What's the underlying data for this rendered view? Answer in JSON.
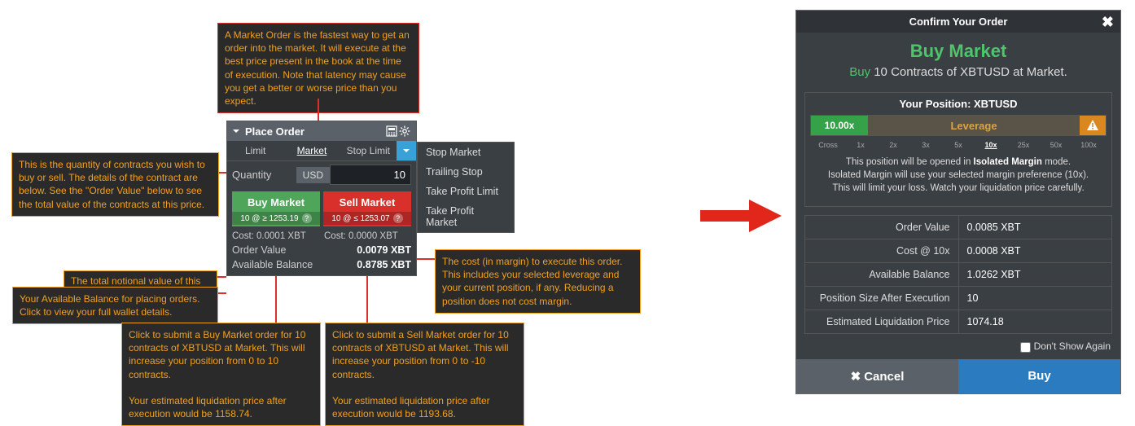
{
  "tooltip_market": "A Market Order is the fastest way to get an order into the market. It will execute at the best price present in the book at the time of execution. Note that latency may cause you get a better or worse price than you expect.",
  "tooltip_quantity": "This is the quantity of contracts you wish to buy or sell. The details of the contract are below. See the \"Order Value\" below to see the total value of the contracts at this price.",
  "tooltip_order_value": "The total notional value of this order.",
  "tooltip_avail": "Your Available Balance for placing orders. Click to view your full wallet details.",
  "tooltip_buy": "Click to submit a Buy Market order for 10 contracts of XBTUSD at Market. This will increase your position from 0 to 10 contracts.\n\nYour estimated liquidation price after execution would be 1158.74.",
  "tooltip_sell": "Click to submit a Sell Market order for 10 contracts of XBTUSD at Market. This will increase your position from 0 to -10 contracts.\n\nYour estimated liquidation price after execution would be 1193.68.",
  "tooltip_cost": "The cost (in margin) to execute this order. This includes your selected leverage and your current position, if any. Reducing a position does not cost margin.",
  "panel": {
    "title": "Place Order",
    "tabs": [
      "Limit",
      "Market",
      "Stop Limit"
    ],
    "qty_label": "Quantity",
    "ccy": "USD",
    "qty_value": "10",
    "buy_label": "Buy Market",
    "buy_sub": "10 @ ≥ 1253.19",
    "sell_label": "Sell Market",
    "sell_sub": "10 @ ≤ 1253.07",
    "cost_buy": "Cost: 0.0001 XBT",
    "cost_sell": "Cost: 0.0000 XBT",
    "order_value_k": "Order Value",
    "order_value_v": "0.0079 XBT",
    "avail_k": "Available Balance",
    "avail_v": "0.8785 XBT"
  },
  "dropdown": [
    "Stop Market",
    "Trailing Stop",
    "Take Profit Limit",
    "Take Profit Market"
  ],
  "dialog": {
    "head": "Confirm Your Order",
    "title": "Buy Market",
    "sub_buy": "Buy",
    "sub_rest": " 10 Contracts of XBTUSD at Market.",
    "pos_title": "Your Position: XBTUSD",
    "lev_val": "10.00x",
    "lev_label": "Leverage",
    "ticks": [
      "Cross",
      "1x",
      "2x",
      "3x",
      "5x",
      "10x",
      "25x",
      "50x",
      "100x"
    ],
    "tick_active": "10x",
    "note1": "This position will be opened in ",
    "note1b": "Isolated Margin",
    "note1c": " mode.",
    "note2": "Isolated Margin will use your selected margin preference (10x).",
    "note3": "This will limit your loss. Watch your liquidation price carefully.",
    "rows": [
      {
        "k": "Order Value",
        "v": "0.0085 XBT"
      },
      {
        "k": "Cost @ 10x",
        "v": "0.0008 XBT"
      },
      {
        "k": "Available Balance",
        "v": "1.0262 XBT"
      },
      {
        "k": "Position Size After Execution",
        "v": "10"
      },
      {
        "k": "Estimated Liquidation Price",
        "v": "1074.18"
      }
    ],
    "dont": "Don't Show Again",
    "cancel": "Cancel",
    "buy": "Buy"
  }
}
